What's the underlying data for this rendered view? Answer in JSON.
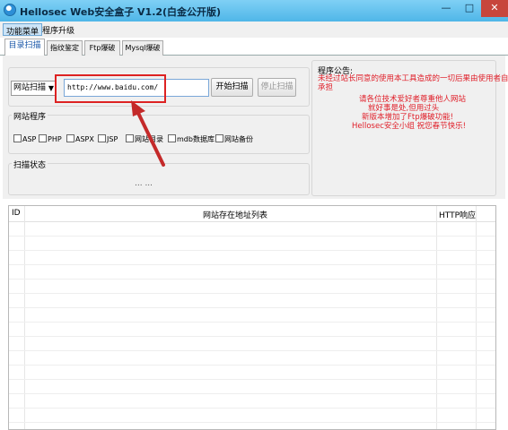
{
  "window": {
    "title": "Hellosec Web安全盒子 V1.2(白金公开版)",
    "min_glyph": "—",
    "max_glyph": "□",
    "close_glyph": "✕"
  },
  "menu": [
    "功能菜单",
    "程序升级"
  ],
  "tabs": [
    "目录扫描",
    "指纹鉴定",
    "Ftp爆破",
    "Mysql爆破"
  ],
  "scan": {
    "mode": "网站扫描",
    "url": "http://www.baidu.com/",
    "start_label": "开始扫描",
    "stop_label": "停止扫描"
  },
  "program_group": {
    "title": "网站程序",
    "options": [
      "ASP",
      "PHP",
      "ASPX",
      "JSP",
      "网站目录",
      "mdb数据库",
      "网站备份"
    ]
  },
  "status_group": {
    "title": "扫描状态",
    "text": "... ..."
  },
  "notice": {
    "title": "程序公告:",
    "lines": [
      "未经过站长同意的使用本工具造成的一切后果由使用者自行",
      "承担",
      "请各位技术爱好者尊重他人网站",
      "就好事是处,但用过头",
      "新版本增加了Ftp爆破功能!",
      "Hellosec安全小组 祝您春节快乐!"
    ]
  },
  "table": {
    "columns": [
      "ID",
      "网站存在地址列表",
      "HTTP响应"
    ]
  }
}
